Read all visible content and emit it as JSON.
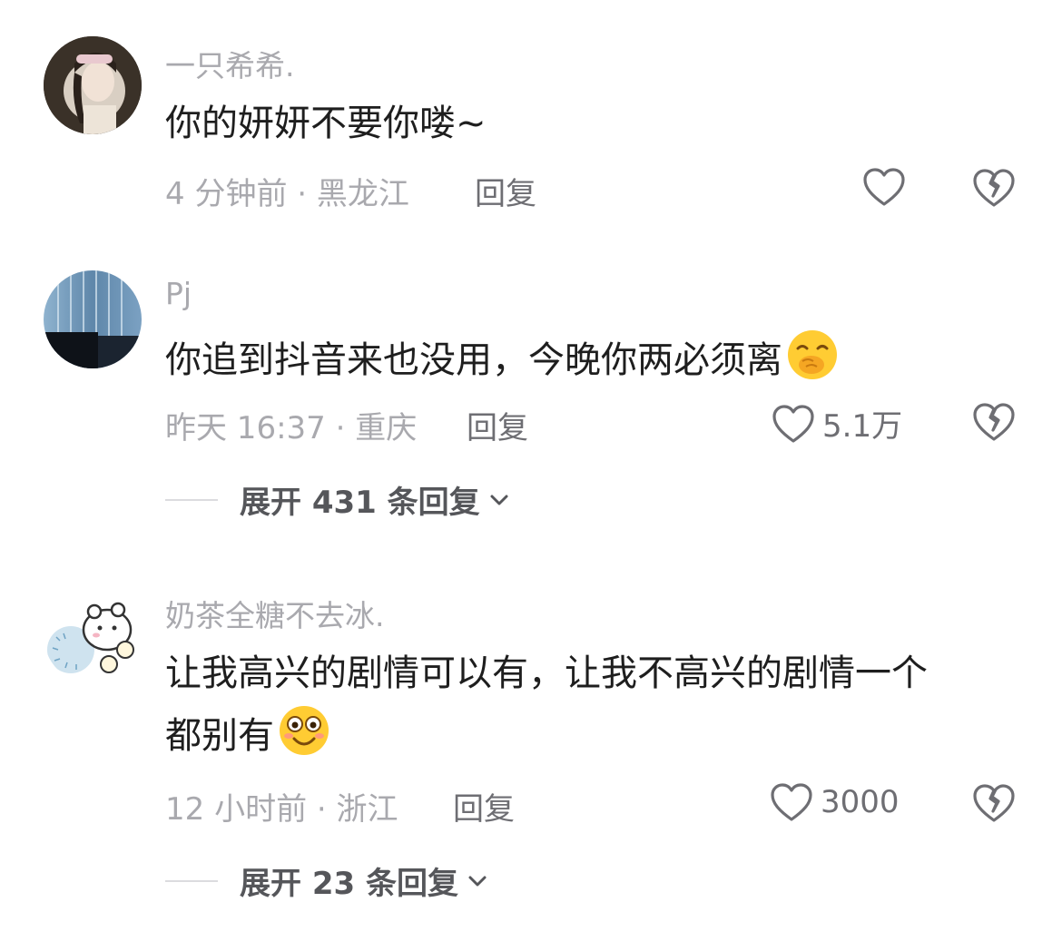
{
  "comments": [
    {
      "username": "一只希希.",
      "text": "你的妍妍不要你喽~",
      "meta": "4 分钟前 · 黑龙江",
      "reply_label": "回复",
      "like_count": "",
      "expand_label": "",
      "avatar": "girl-portrait"
    },
    {
      "username": "Pj",
      "text": "你追到抖音来也没用，今晚你两必须离",
      "text_emoji": "hand-over-mouth-emoji",
      "meta": "昨天 16:37 · 重庆",
      "reply_label": "回复",
      "like_count": "5.1万",
      "expand_label": "展开 431 条回复",
      "avatar": "blue-curtain"
    },
    {
      "username": "奶茶全糖不去冰.",
      "text_line1": "让我高兴的剧情可以有，让我不高兴的剧情一个",
      "text_line2": "都别有",
      "text_emoji": "flushed-smile-emoji",
      "meta": "12 小时前 · 浙江",
      "reply_label": "回复",
      "like_count": "3000",
      "expand_label": "展开 23 条回复",
      "avatar": "cartoon-animal"
    }
  ],
  "colors": {
    "muted_text": "#a9a9ae",
    "icon": "#6e6e73",
    "main_text": "#1e1e1e"
  }
}
